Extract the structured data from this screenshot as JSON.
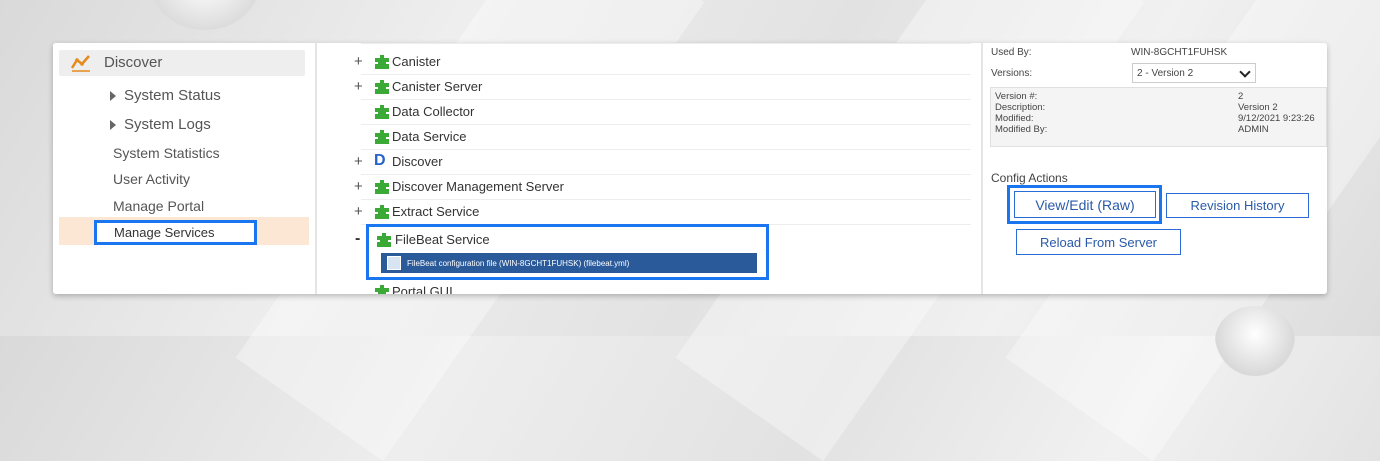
{
  "sidebar": {
    "header_label": "Discover",
    "items": [
      {
        "label": "System Status"
      },
      {
        "label": "System Logs"
      }
    ],
    "subitems": [
      {
        "label": "System Statistics"
      },
      {
        "label": "User Activity"
      },
      {
        "label": "Manage Portal"
      },
      {
        "label": "Manage Services"
      }
    ]
  },
  "tree": {
    "rows": [
      {
        "label": "Canister",
        "prefix": "+"
      },
      {
        "label": "Canister Server",
        "prefix": "+"
      },
      {
        "label": "Data Collector",
        "prefix": ""
      },
      {
        "label": "Data Service",
        "prefix": ""
      },
      {
        "label": "Discover",
        "prefix": "+"
      },
      {
        "label": "Discover Management Server",
        "prefix": "+"
      },
      {
        "label": "Extract Service",
        "prefix": "+"
      },
      {
        "label": "FileBeat Service",
        "prefix": "-"
      },
      {
        "label": "Portal GUI",
        "prefix": ""
      }
    ],
    "file_item": "FileBeat configuration file (WIN-8GCHT1FUHSK) (filebeat.yml)"
  },
  "panel": {
    "used_by_label": "Used By:",
    "used_by_value": "WIN-8GCHT1FUHSK",
    "versions_label": "Versions:",
    "versions_selected": "2 - Version 2",
    "details": {
      "version_label": "Version #:",
      "version_value": "2",
      "description_label": "Description:",
      "description_value": "Version 2",
      "modified_label": "Modified:",
      "modified_value": "9/12/2021 9:23:26",
      "modified_by_label": "Modified By:",
      "modified_by_value": "ADMIN"
    },
    "config_actions_label": "Config Actions",
    "buttons": {
      "view_edit": "View/Edit (Raw)",
      "revision_history": "Revision History",
      "reload": "Reload From Server"
    }
  },
  "colors": {
    "highlight": "#1976f0",
    "active_bg": "#fbe7d3",
    "puzzle_green": "#3aa935",
    "file_item_bg": "#2a5a9a"
  }
}
